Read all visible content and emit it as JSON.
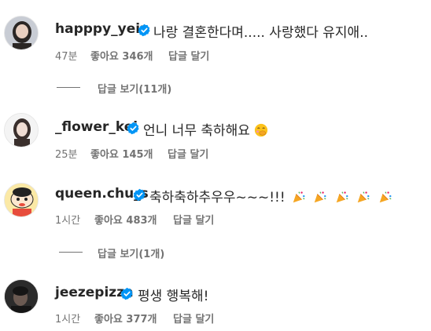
{
  "colors": {
    "verified": "#0095f6",
    "text": "#262626",
    "meta": "#737373"
  },
  "comments": [
    {
      "username": "happpy_yein",
      "text": "나랑 결혼한다며..... 사랑했다 유지애..",
      "time": "47분",
      "likes": "좋아요 346개",
      "reply": "답글 달기",
      "view_replies": "답글 보기(11개)"
    },
    {
      "username": "_flower_kei",
      "text": "언니 너무 축하해요",
      "emoji": "face-with-hand-over-mouth-emoji",
      "time": "25분",
      "likes": "좋아요 145개",
      "reply": "답글 달기"
    },
    {
      "username": "queen.chu_s",
      "text": "축하축하추우우~~~!!!",
      "emoji": "party-popper-emoji",
      "time": "1시간",
      "likes": "좋아요 483개",
      "reply": "답글 달기",
      "view_replies": "답글 보기(1개)"
    },
    {
      "username": "jeezepizza",
      "text": "평생 행복해!",
      "time": "1시간",
      "likes": "좋아요 377개",
      "reply": "답글 달기"
    }
  ]
}
